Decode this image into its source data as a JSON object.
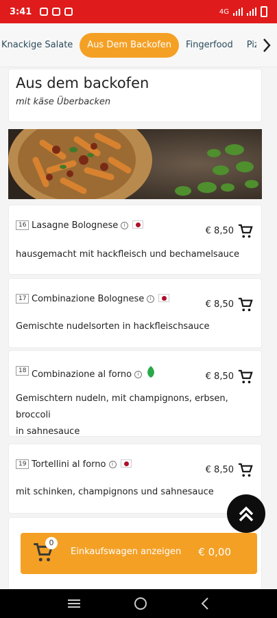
{
  "status_bar": {
    "time": "3:41",
    "network": "4G"
  },
  "tabs": [
    {
      "label": "Knackige Salate",
      "active": false
    },
    {
      "label": "Aus Dem Backofen",
      "active": true
    },
    {
      "label": "Fingerfood",
      "active": false
    },
    {
      "label": "Piz",
      "active": false
    }
  ],
  "category": {
    "title": "Aus dem backofen",
    "subtitle": "mit käse Überbacken"
  },
  "items": [
    {
      "number": "16",
      "name": "Lasagne Bolognese",
      "price": "€ 8,50",
      "tag": "flag",
      "description": [
        "hausgemacht mit hackfleisch und bechamelsauce"
      ]
    },
    {
      "number": "17",
      "name": "Combinazione Bolognese",
      "price": "€ 8,50",
      "tag": "flag",
      "description": [
        "Gemischte nudelsorten in hackfleischsauce"
      ]
    },
    {
      "number": "18",
      "name": "Combinazione al forno",
      "price": "€ 8,50",
      "tag": "leaf",
      "description": [
        "Gemischtern nudeln, mit champignons, erbsen, broccoli",
        "in sahnesauce"
      ]
    },
    {
      "number": "19",
      "name": "Tortellini al forno",
      "price": "€ 8,50",
      "tag": "flag",
      "description": [
        "mit schinken, champignons und sahnesauce"
      ]
    }
  ],
  "cart": {
    "count": "0",
    "label": "Einkaufswagen anzeigen",
    "total": "€ 0,00"
  },
  "colors": {
    "accent": "#f4a025",
    "status_bar": "#e01b1b"
  }
}
